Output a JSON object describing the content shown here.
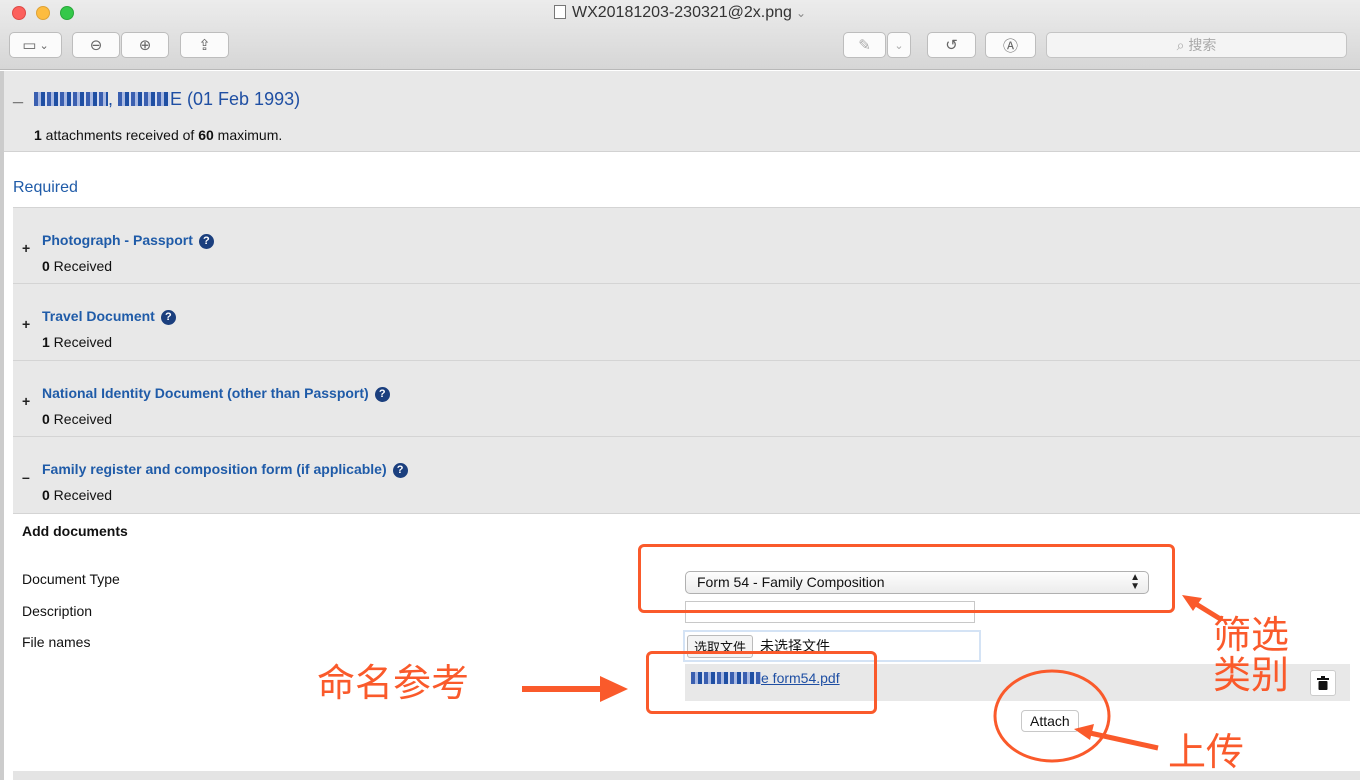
{
  "window": {
    "title": "WX20181203-230321@2x.png",
    "search_placeholder": "搜索"
  },
  "person": {
    "name_visible": "E (01 Feb 1993)",
    "attachments_received": "1",
    "attachments_mid": " attachments received of ",
    "attachments_max": "60",
    "attachments_tail": " maximum."
  },
  "required_label": "Required",
  "sections": [
    {
      "toggle": "+",
      "title": "Photograph - Passport",
      "count": "0",
      "received_label": " Received"
    },
    {
      "toggle": "+",
      "title": "Travel Document",
      "count": "1",
      "received_label": " Received"
    },
    {
      "toggle": "+",
      "title": "National Identity Document (other than Passport)",
      "count": "0",
      "received_label": " Received"
    },
    {
      "toggle": "–",
      "title": "Family register and composition form (if applicable)",
      "count": "0",
      "received_label": " Received"
    }
  ],
  "add_docs": {
    "title": "Add documents",
    "doc_type_label": "Document Type",
    "description_label": "Description",
    "file_names_label": "File names",
    "doc_type_value": "Form 54 - Family Composition",
    "file_button": "选取文件",
    "file_none": "未选择文件",
    "attached_file": "e form54.pdf",
    "attach_button": "Attach"
  },
  "annotations": {
    "filter": "筛选\n类别",
    "naming": "命名参考",
    "upload": "上传"
  },
  "colors": {
    "annotation": "#fa5a2b",
    "link": "#1f4fa3"
  }
}
